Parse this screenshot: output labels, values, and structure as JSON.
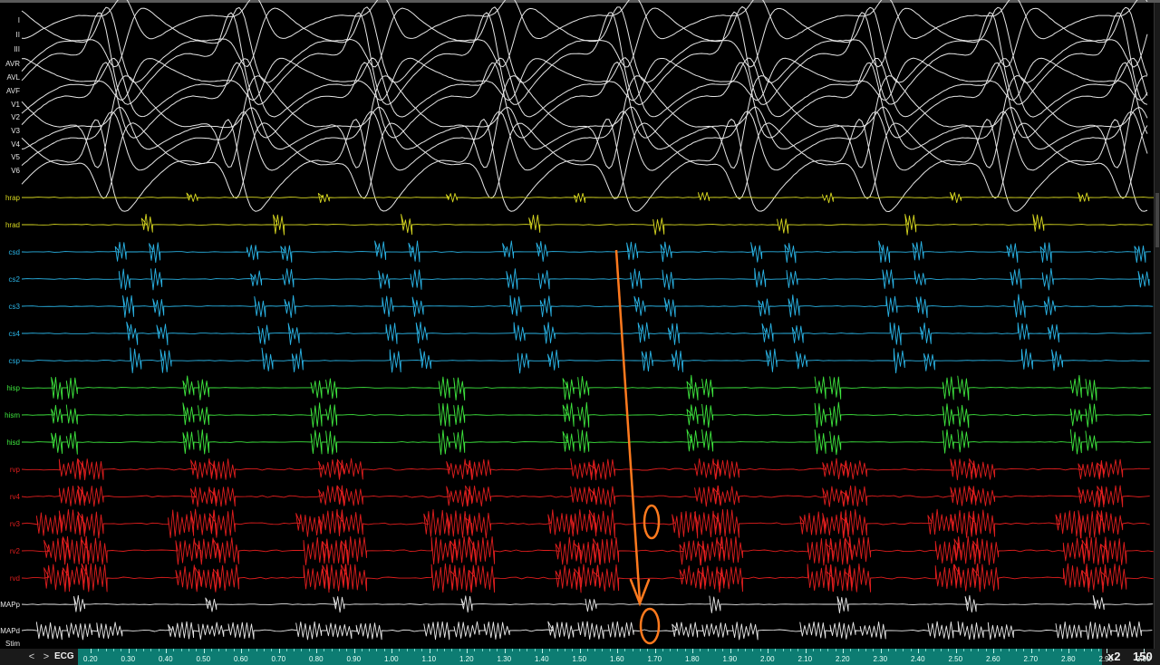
{
  "channels": [
    {
      "label": "I",
      "group": "ecg"
    },
    {
      "label": "II",
      "group": "ecg"
    },
    {
      "label": "III",
      "group": "ecg"
    },
    {
      "label": "AVR",
      "group": "ecg"
    },
    {
      "label": "AVL",
      "group": "ecg"
    },
    {
      "label": "AVF",
      "group": "ecg"
    },
    {
      "label": "V1",
      "group": "ecg"
    },
    {
      "label": "V2",
      "group": "ecg"
    },
    {
      "label": "V3",
      "group": "ecg"
    },
    {
      "label": "V4",
      "group": "ecg"
    },
    {
      "label": "V5",
      "group": "ecg"
    },
    {
      "label": "V6",
      "group": "ecg"
    },
    {
      "label": "hrap",
      "group": "hra"
    },
    {
      "label": "hrad",
      "group": "hra"
    },
    {
      "label": "csd",
      "group": "cs"
    },
    {
      "label": "cs2",
      "group": "cs"
    },
    {
      "label": "cs3",
      "group": "cs"
    },
    {
      "label": "cs4",
      "group": "cs"
    },
    {
      "label": "csp",
      "group": "cs"
    },
    {
      "label": "hisp",
      "group": "his"
    },
    {
      "label": "hism",
      "group": "his"
    },
    {
      "label": "hisd",
      "group": "his"
    },
    {
      "label": "rvp",
      "group": "rv"
    },
    {
      "label": "rv4",
      "group": "rv"
    },
    {
      "label": "rv3",
      "group": "rv"
    },
    {
      "label": "rv2",
      "group": "rv"
    },
    {
      "label": "rvd",
      "group": "rv"
    },
    {
      "label": "MAPp",
      "group": "map"
    },
    {
      "label": "MAPd",
      "group": "map"
    },
    {
      "label": "Stim",
      "group": "stim"
    }
  ],
  "group_colors": {
    "ecg": "#e6e6e6",
    "hra": "#d8d820",
    "cs": "#2ab4e6",
    "his": "#3ee63e",
    "rv": "#e01e1e",
    "map": "#e8e8e8",
    "stim": "#e8e8e8"
  },
  "beat_times": [
    0.37,
    0.72,
    1.06,
    1.4,
    1.73,
    2.06,
    2.4,
    2.74,
    3.08
  ],
  "annotation": {
    "color": "#ff7a1e"
  },
  "toolbar": {
    "prev_label": "<",
    "next_label": ">",
    "ecg_label": "ECG",
    "zoom_label": "x2",
    "speed_label": "150"
  },
  "timeline": {
    "ticks": [
      "0.20",
      "0.30",
      "0.40",
      "0.50",
      "0.60",
      "0.70",
      "0.80",
      "0.90",
      "1.00",
      "1.10",
      "1.20",
      "1.30",
      "1.40",
      "1.50",
      "1.60",
      "1.70",
      "1.80",
      "1.90",
      "2.00",
      "2.10",
      "2.20",
      "2.30",
      "2.40",
      "2.50",
      "2.60",
      "2.70",
      "2.80",
      "2.90",
      "3.00"
    ],
    "start": 0.2,
    "end": 3.0,
    "unit": "s"
  }
}
